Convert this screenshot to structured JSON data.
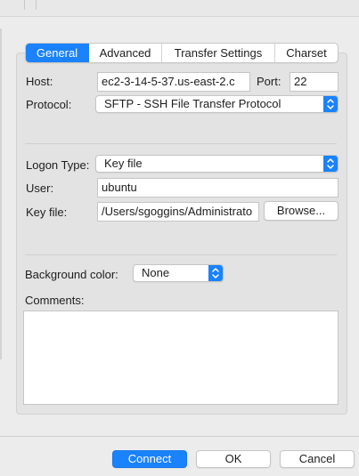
{
  "tabs": [
    {
      "label": "General",
      "active": true
    },
    {
      "label": "Advanced",
      "active": false
    },
    {
      "label": "Transfer Settings",
      "active": false
    },
    {
      "label": "Charset",
      "active": false
    }
  ],
  "general": {
    "host_label": "Host:",
    "host_value": "ec2-3-14-5-37.us-east-2.c",
    "port_label": "Port:",
    "port_value": "22",
    "protocol_label": "Protocol:",
    "protocol_value": "SFTP - SSH File Transfer Protocol",
    "logon_type_label": "Logon Type:",
    "logon_type_value": "Key file",
    "user_label": "User:",
    "user_value": "ubuntu",
    "key_file_label": "Key file:",
    "key_file_value": "/Users/sgoggins/Administrato",
    "browse_label": "Browse...",
    "bg_color_label": "Background color:",
    "bg_color_value": "None",
    "comments_label": "Comments:",
    "comments_value": ""
  },
  "footer": {
    "connect_label": "Connect",
    "ok_label": "OK",
    "cancel_label": "Cancel"
  },
  "colors": {
    "accent": "#1a82fb",
    "panel_bg": "#e3e3e3",
    "window_bg": "#ececec"
  }
}
